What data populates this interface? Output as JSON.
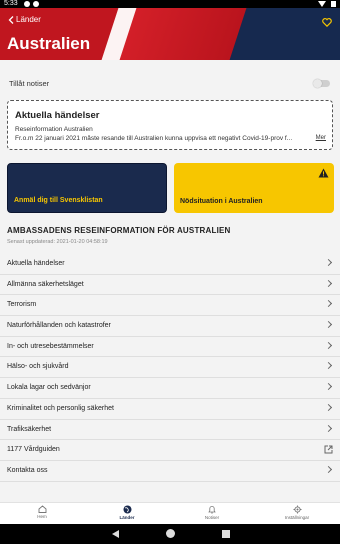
{
  "status_bar": {
    "time": "5:33"
  },
  "header": {
    "back_label": "Länder",
    "title": "Australien"
  },
  "notifications": {
    "label": "Tillåt notiser",
    "enabled": false
  },
  "current_events": {
    "title": "Aktuella händelser",
    "subtitle": "Reseinformation Australien",
    "body": "Fr.o.m 22 januari 2021 måste resande till Australien kunna uppvisa ett negativt Covid-19-prov f...",
    "more_label": "Mer"
  },
  "tiles": {
    "register_label": "Anmäl dig till Svensklistan",
    "emergency_label": "Nödsituation i Australien"
  },
  "section": {
    "title": "AMBASSADENS RESEINFORMATION FÖR AUSTRALIEN",
    "updated": "Senast uppdaterad: 2021-01-20 04:58:19"
  },
  "list_items": [
    {
      "label": "Aktuella händelser",
      "icon": "chevron-right"
    },
    {
      "label": "Allmänna säkerhetsläget",
      "icon": "chevron-right"
    },
    {
      "label": "Terrorism",
      "icon": "chevron-right"
    },
    {
      "label": "Naturförhållanden och katastrofer",
      "icon": "chevron-right"
    },
    {
      "label": "In- och utresebestämmelser",
      "icon": "chevron-right"
    },
    {
      "label": "Hälso- och sjukvård",
      "icon": "chevron-right"
    },
    {
      "label": "Lokala lagar och sedvänjor",
      "icon": "chevron-right"
    },
    {
      "label": "Kriminalitet och personlig säkerhet",
      "icon": "chevron-right"
    },
    {
      "label": "Trafiksäkerhet",
      "icon": "chevron-right"
    },
    {
      "label": "1177 Vårdguiden",
      "icon": "external-link"
    },
    {
      "label": "Kontakta oss",
      "icon": "chevron-right"
    }
  ],
  "bottom_nav": [
    {
      "label": "Hem",
      "icon": "home-icon",
      "active": false
    },
    {
      "label": "Länder",
      "icon": "globe-icon",
      "active": true
    },
    {
      "label": "Notiser",
      "icon": "bell-icon",
      "active": false
    },
    {
      "label": "Inställningar",
      "icon": "gear-icon",
      "active": false
    }
  ],
  "colors": {
    "header_red": "#c0161f",
    "navy": "#1a2a4d",
    "yellow": "#f7c600"
  }
}
